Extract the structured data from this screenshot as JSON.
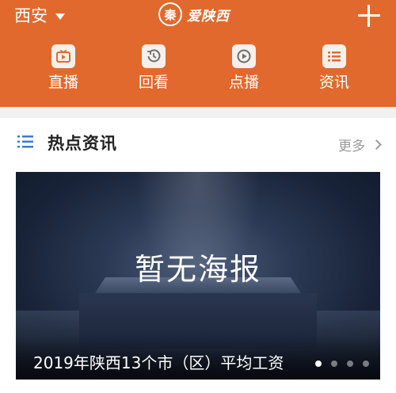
{
  "header": {
    "city": "西安",
    "logo_seal_text": "秦",
    "logo_text": "爱陕西"
  },
  "nav": {
    "items": [
      {
        "label": "直播",
        "icon": "tv-icon"
      },
      {
        "label": "回看",
        "icon": "replay-icon"
      },
      {
        "label": "点播",
        "icon": "play-icon"
      },
      {
        "label": "资讯",
        "icon": "list-icon"
      }
    ]
  },
  "section": {
    "title": "热点资讯",
    "more": "更多"
  },
  "banner": {
    "poster_text": "暂无海报",
    "caption": "2019年陕西13个市（区）平均工资",
    "dots_total": 4,
    "active_dot": 1
  },
  "colors": {
    "header_bg": "#e2692d",
    "accent_blue": "#3a7bd5"
  }
}
